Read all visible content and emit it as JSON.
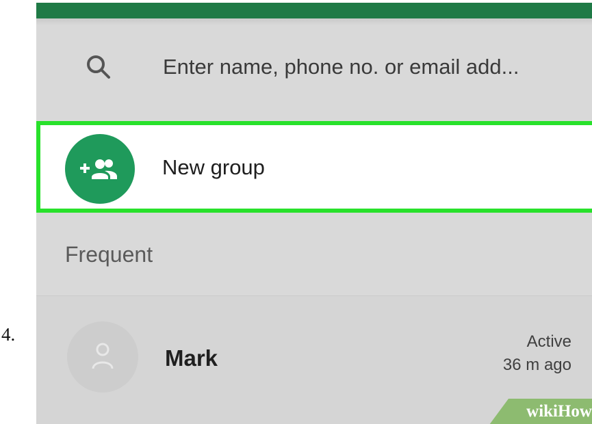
{
  "step_number": "4.",
  "search": {
    "placeholder": "Enter name, phone no. or email add...",
    "icon": "search-icon"
  },
  "new_group": {
    "label": "New group",
    "icon": "group-add-icon",
    "highlight_color": "#28e12b",
    "avatar_color": "#1f9a5b"
  },
  "section": {
    "title": "Frequent"
  },
  "contacts": [
    {
      "name": "Mark",
      "status_line1": "Active",
      "status_line2": "36 m ago",
      "avatar_icon": "person-icon"
    }
  ],
  "watermark": {
    "text": "wikiHow"
  },
  "colors": {
    "top_bar": "#1f7a46",
    "background": "#d9d9d9"
  }
}
